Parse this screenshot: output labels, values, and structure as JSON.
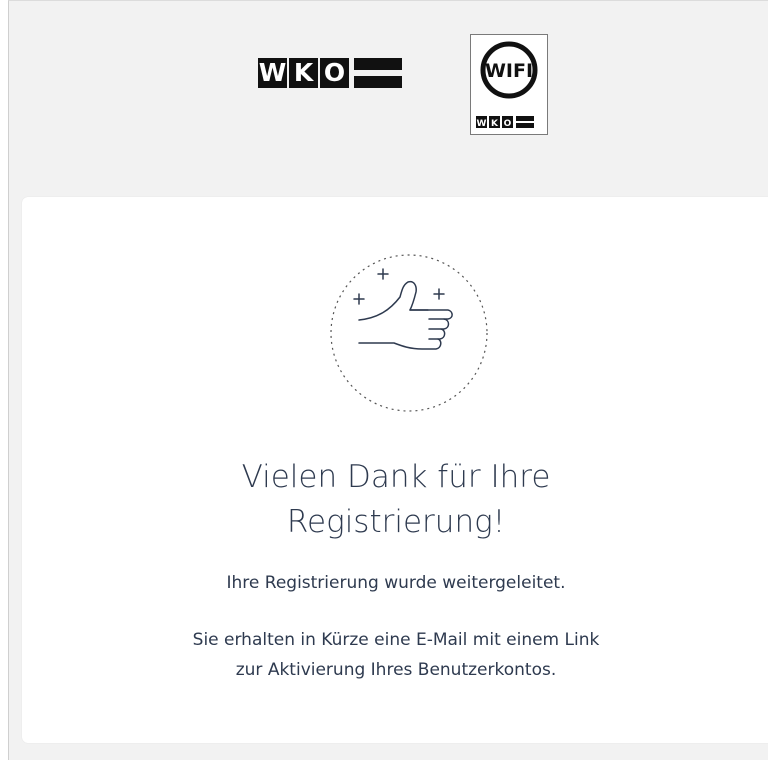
{
  "header": {
    "wko_letters": [
      "W",
      "K",
      "O"
    ],
    "wifi_badge_text": "WIFI",
    "wifi_sub_letters": [
      "W",
      "K",
      "O"
    ]
  },
  "card": {
    "icon": "thumbs-up-icon",
    "title_line1": "Vielen Dank für Ihre",
    "title_line2": "Registrierung!",
    "message": "Ihre Registrierung wurde weitergeleitet.",
    "info_line1": "Sie erhalten in Kürze eine E-Mail mit einem Link",
    "info_line2": "zur Aktivierung Ihres Benutzerkontos."
  },
  "colors": {
    "page_background": "#f2f2f2",
    "card_background": "#ffffff",
    "text": "#2e3a4f",
    "logo": "#111111"
  }
}
